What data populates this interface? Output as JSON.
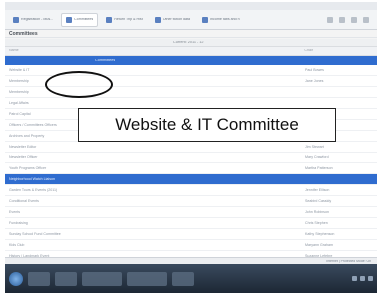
{
  "callout": {
    "text": "Website & IT Committee"
  },
  "tabs": [
    {
      "label": "Registration - Mus..."
    },
    {
      "label": "Committees"
    },
    {
      "label": "Return Trip & Hist"
    },
    {
      "label": "Other fiction data"
    },
    {
      "label": "Income tabs and n"
    }
  ],
  "page": {
    "title": "Committees"
  },
  "list": {
    "filter_label": "Current: 2011 - 12",
    "columns": [
      "Name",
      "Chair"
    ],
    "group_label": "Committees",
    "rows": [
      {
        "name": "Website & IT",
        "chair": "Paul Bowes"
      },
      {
        "name": "Membership",
        "chair": "Jane Jones"
      },
      {
        "name": "Membership",
        "chair": ""
      },
      {
        "name": "Legal Affairs",
        "chair": ""
      },
      {
        "name": "Patrol Capital",
        "chair": ""
      },
      {
        "name": "Officers / Committees Officers",
        "chair": ""
      },
      {
        "name": "Archives and Property",
        "chair": "Michael Knight"
      },
      {
        "name": "Newsletter Editor",
        "chair": "Jim Stewart"
      },
      {
        "name": "Newsletter Officer",
        "chair": "Mary Crawford"
      },
      {
        "name": "Youth Programs Officer",
        "chair": "Martha Patterson"
      },
      {
        "name": "Neighborhood Watch Liaison",
        "chair": ""
      },
      {
        "name": "Garden Tours & Events (2011)",
        "chair": "Jennifer Ellison"
      },
      {
        "name": "Conditional Events",
        "chair": "Seabird Cassidy"
      },
      {
        "name": "Events",
        "chair": "John Robinson"
      },
      {
        "name": "Fundraising",
        "chair": "Chris Stephen"
      },
      {
        "name": "Sunday School Fund Committee",
        "chair": "Kathy Stephenson"
      },
      {
        "name": "Kids Club",
        "chair": "Maryann Graham"
      },
      {
        "name": "History / Landmark Event",
        "chair": "Suzanne Lefebre"
      },
      {
        "name": "Playground Fund",
        "chair": "John Grant"
      },
      {
        "name": "Christmas Lights / Traffic / Sidewalk Traffic Fund",
        "chair": "John Fears"
      }
    ],
    "highlighted_row_index": 10
  },
  "status_text": "Internet | Protected Mode: On"
}
